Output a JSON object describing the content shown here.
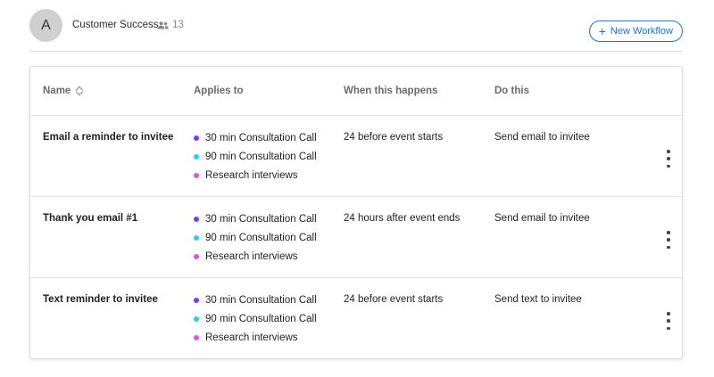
{
  "header": {
    "avatar_letter": "A",
    "team_name": "Customer Success",
    "member_count": "13",
    "new_workflow_label": "New Workflow"
  },
  "colors": {
    "accent": "#1a73e8",
    "dot_30min": "#7c3aed",
    "dot_90min": "#22d3ee",
    "dot_research": "#e052e8"
  },
  "table": {
    "columns": [
      "Name",
      "Applies to",
      "When this happens",
      "Do this"
    ],
    "rows": [
      {
        "name": "Email a reminder to invitee",
        "applies_to": [
          "30 min Consultation Call",
          "90 min Consultation Call",
          "Research interviews"
        ],
        "when": "24 before event starts",
        "action": "Send email to invitee"
      },
      {
        "name": "Thank you email #1",
        "applies_to": [
          "30 min Consultation Call",
          "90 min Consultation Call",
          "Research interviews"
        ],
        "when": "24 hours after event ends",
        "action": "Send email to invitee"
      },
      {
        "name": "Text reminder to invitee",
        "applies_to": [
          "30 min Consultation Call",
          "90 min Consultation Call",
          "Research interviews"
        ],
        "when": "24 before event starts",
        "action": "Send text to invitee"
      }
    ]
  }
}
